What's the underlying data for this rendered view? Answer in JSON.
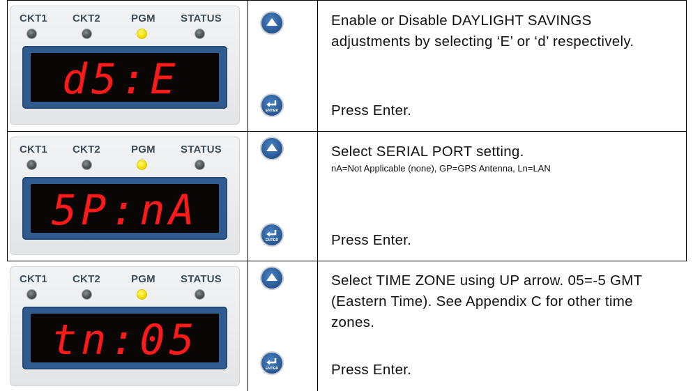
{
  "panel": {
    "labels": {
      "ckt1": "CKT1",
      "ckt2": "CKT2",
      "pgm": "PGM",
      "status": "STATUS"
    }
  },
  "buttons": {
    "up_icon": "up-arrow-button",
    "enter_icon": "enter-button",
    "enter_text": "ENTER"
  },
  "rows": [
    {
      "display": "d5:E",
      "description": "Enable or Disable DAYLIGHT SAVINGS adjustments by selecting ‘E’ or ‘d’ respectively.",
      "press": "Press Enter."
    },
    {
      "display": "5P:nA",
      "description": "Select SERIAL PORT setting.",
      "note": "nA=Not Applicable (none), GP=GPS Antenna, Ln=LAN",
      "press": "Press Enter."
    },
    {
      "display": "tn:05",
      "description": "Select TIME ZONE using UP arrow. 05=-5 GMT (Eastern Time).  See Appendix C for other time zones.",
      "press": "Press Enter."
    }
  ],
  "colors": {
    "led_on": "#f5e000",
    "display": "#ff1a1a",
    "bezel": "#2f5b8f",
    "button": "#2a5c98"
  }
}
